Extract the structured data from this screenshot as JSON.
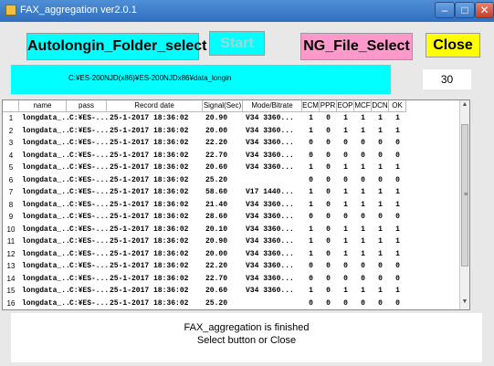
{
  "window": {
    "title": "FAX_aggregation  ver2.0.1"
  },
  "buttons": {
    "autologin": "Autolongin_Folder_select",
    "start": "Start",
    "ng": "NG_File_Select",
    "close": "Close"
  },
  "path": "C:¥ES-200NJD(x86)¥ES-200NJDx86¥data_longin",
  "count": "30",
  "table": {
    "columns": [
      "name",
      "pass",
      "Record date",
      "Signal(Sec)",
      "Mode/Bitrate",
      "ECM",
      "PPR",
      "EOP",
      "MCF",
      "DCN",
      "OK"
    ],
    "rows": [
      {
        "n": "1",
        "name": "longdata_...",
        "pass": "C:¥ES-...",
        "date": "25-1-2017 18:36:02",
        "signal": "20.90",
        "mode": "V34 3360...",
        "ecm": "1",
        "ppr": "0",
        "eop": "1",
        "mcf": "1",
        "dcn": "1",
        "ok": "1"
      },
      {
        "n": "2",
        "name": "longdata_...",
        "pass": "C:¥ES-...",
        "date": "25-1-2017 18:36:02",
        "signal": "20.00",
        "mode": "V34 3360...",
        "ecm": "1",
        "ppr": "0",
        "eop": "1",
        "mcf": "1",
        "dcn": "1",
        "ok": "1"
      },
      {
        "n": "3",
        "name": "longdata_...",
        "pass": "C:¥ES-...",
        "date": "25-1-2017 18:36:02",
        "signal": "22.20",
        "mode": "V34 3360...",
        "ecm": "0",
        "ppr": "0",
        "eop": "0",
        "mcf": "0",
        "dcn": "0",
        "ok": "0"
      },
      {
        "n": "4",
        "name": "longdata_...",
        "pass": "C:¥ES-...",
        "date": "25-1-2017 18:36:02",
        "signal": "22.70",
        "mode": "V34 3360...",
        "ecm": "0",
        "ppr": "0",
        "eop": "0",
        "mcf": "0",
        "dcn": "0",
        "ok": "0"
      },
      {
        "n": "5",
        "name": "longdata_...",
        "pass": "C:¥ES-...",
        "date": "25-1-2017 18:36:02",
        "signal": "20.60",
        "mode": "V34 3360...",
        "ecm": "1",
        "ppr": "0",
        "eop": "1",
        "mcf": "1",
        "dcn": "1",
        "ok": "1"
      },
      {
        "n": "6",
        "name": "longdata_...",
        "pass": "C:¥ES-...",
        "date": "25-1-2017 18:36:02",
        "signal": "25.20",
        "mode": "",
        "ecm": "0",
        "ppr": "0",
        "eop": "0",
        "mcf": "0",
        "dcn": "0",
        "ok": "0"
      },
      {
        "n": "7",
        "name": "longdata_...",
        "pass": "C:¥ES-...",
        "date": "25-1-2017 18:36:02",
        "signal": "58.60",
        "mode": "V17 1440...",
        "ecm": "1",
        "ppr": "0",
        "eop": "1",
        "mcf": "1",
        "dcn": "1",
        "ok": "1"
      },
      {
        "n": "8",
        "name": "longdata_...",
        "pass": "C:¥ES-...",
        "date": "25-1-2017 18:36:02",
        "signal": "21.40",
        "mode": "V34 3360...",
        "ecm": "1",
        "ppr": "0",
        "eop": "1",
        "mcf": "1",
        "dcn": "1",
        "ok": "1"
      },
      {
        "n": "9",
        "name": "longdata_...",
        "pass": "C:¥ES-...",
        "date": "25-1-2017 18:36:02",
        "signal": "28.60",
        "mode": "V34 3360...",
        "ecm": "0",
        "ppr": "0",
        "eop": "0",
        "mcf": "0",
        "dcn": "0",
        "ok": "0"
      },
      {
        "n": "10",
        "name": "longdata_...",
        "pass": "C:¥ES-...",
        "date": "25-1-2017 18:36:02",
        "signal": "20.10",
        "mode": "V34 3360...",
        "ecm": "1",
        "ppr": "0",
        "eop": "1",
        "mcf": "1",
        "dcn": "1",
        "ok": "1"
      },
      {
        "n": "11",
        "name": "longdata_...",
        "pass": "C:¥ES-...",
        "date": "25-1-2017 18:36:02",
        "signal": "20.90",
        "mode": "V34 3360...",
        "ecm": "1",
        "ppr": "0",
        "eop": "1",
        "mcf": "1",
        "dcn": "1",
        "ok": "1"
      },
      {
        "n": "12",
        "name": "longdata_...",
        "pass": "C:¥ES-...",
        "date": "25-1-2017 18:36:02",
        "signal": "20.00",
        "mode": "V34 3360...",
        "ecm": "1",
        "ppr": "0",
        "eop": "1",
        "mcf": "1",
        "dcn": "1",
        "ok": "1"
      },
      {
        "n": "13",
        "name": "longdata_...",
        "pass": "C:¥ES-...",
        "date": "25-1-2017 18:36:02",
        "signal": "22.20",
        "mode": "V34 3360...",
        "ecm": "0",
        "ppr": "0",
        "eop": "0",
        "mcf": "0",
        "dcn": "0",
        "ok": "0"
      },
      {
        "n": "14",
        "name": "longdata_...",
        "pass": "C:¥ES-...",
        "date": "25-1-2017 18:36:02",
        "signal": "22.70",
        "mode": "V34 3360...",
        "ecm": "0",
        "ppr": "0",
        "eop": "0",
        "mcf": "0",
        "dcn": "0",
        "ok": "0"
      },
      {
        "n": "15",
        "name": "longdata_...",
        "pass": "C:¥ES-...",
        "date": "25-1-2017 18:36:02",
        "signal": "20.60",
        "mode": "V34 3360...",
        "ecm": "1",
        "ppr": "0",
        "eop": "1",
        "mcf": "1",
        "dcn": "1",
        "ok": "1"
      },
      {
        "n": "16",
        "name": "longdata_...",
        "pass": "C:¥ES-...",
        "date": "25-1-2017 18:36:02",
        "signal": "25.20",
        "mode": "",
        "ecm": "0",
        "ppr": "0",
        "eop": "0",
        "mcf": "0",
        "dcn": "0",
        "ok": "0"
      }
    ]
  },
  "status": {
    "line1": "FAX_aggregation is finished",
    "line2": "Select button or Close"
  },
  "colors": {
    "cyan": "#00ffff",
    "pink": "#ff99cc",
    "yellow": "#ffff00"
  }
}
